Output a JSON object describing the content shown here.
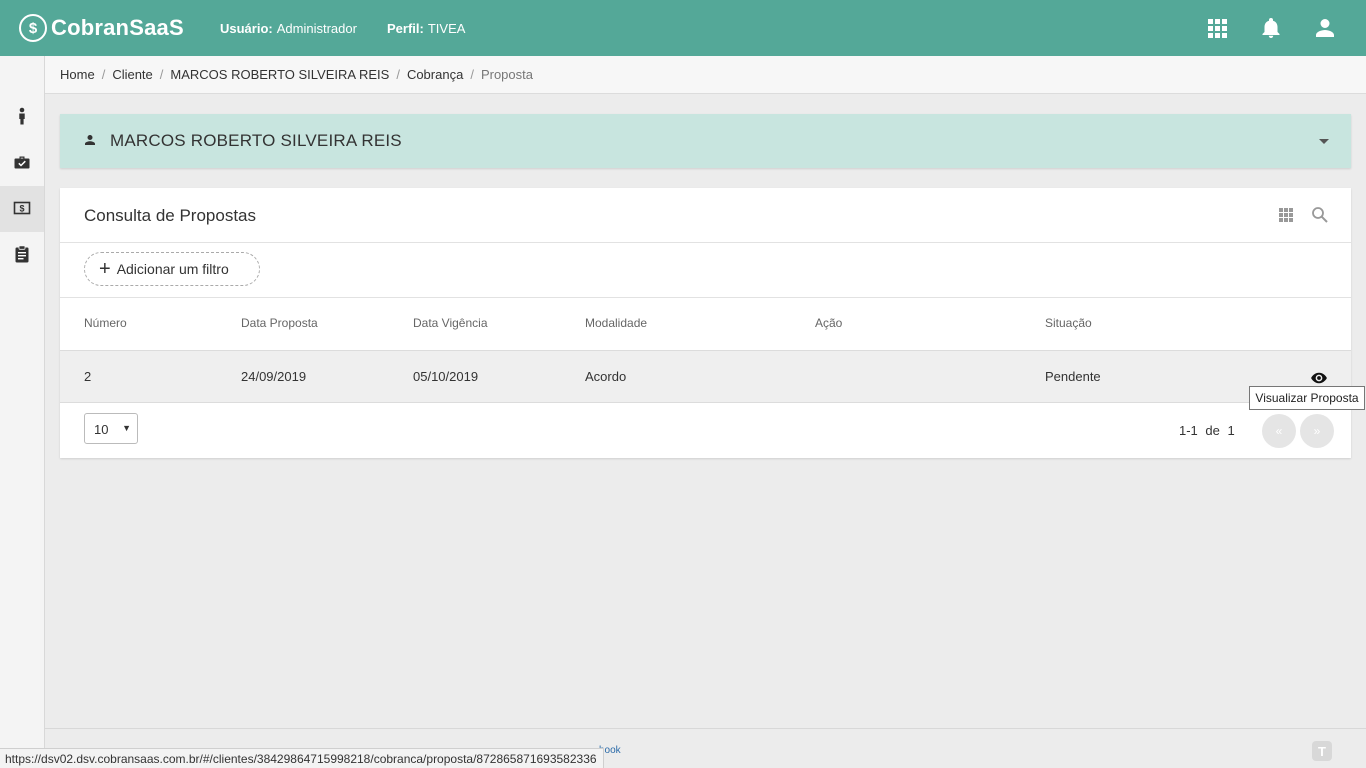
{
  "app": {
    "logo_text": "CobranSaaS"
  },
  "topbar": {
    "user_label": "Usuário:",
    "user_value": "Administrador",
    "profile_label": "Perfil:",
    "profile_value": "TIVEA",
    "icons": [
      "apps-grid-icon",
      "bell-icon",
      "account-icon"
    ]
  },
  "sidebar": {
    "items": [
      {
        "icon": "person-icon"
      },
      {
        "icon": "briefcase-check-icon"
      },
      {
        "icon": "cash-icon",
        "active": true
      },
      {
        "icon": "clipboard-icon"
      }
    ]
  },
  "breadcrumb": [
    "Home",
    "Cliente",
    "MARCOS ROBERTO SILVEIRA REIS",
    "Cobrança",
    "Proposta"
  ],
  "client": {
    "name": "MARCOS ROBERTO SILVEIRA REIS"
  },
  "card": {
    "title": "Consulta de Propostas",
    "add_filter": "Adicionar um filtro",
    "columns": [
      "Número",
      "Data Proposta",
      "Data Vigência",
      "Modalidade",
      "Ação",
      "Situação"
    ],
    "rows": [
      {
        "numero": "2",
        "data_proposta": "24/09/2019",
        "data_vigencia": "05/10/2019",
        "modalidade": "Acordo",
        "acao": "",
        "situacao": "Pendente"
      }
    ],
    "row_action_tooltip": "Visualizar Proposta",
    "page_size": "10",
    "range_from_to": "1-1",
    "range_of": "de",
    "range_total": "1",
    "prev_label": "«",
    "next_label": "»"
  },
  "footer": {
    "link_text": "hook",
    "status_url": "https://dsv02.dsv.cobransaas.com.br/#/clientes/38429864715998218/cobranca/proposta/872865871693582336"
  },
  "colors": {
    "primary": "#54a898",
    "client_panel": "#c8e5df",
    "background": "#ececec"
  }
}
